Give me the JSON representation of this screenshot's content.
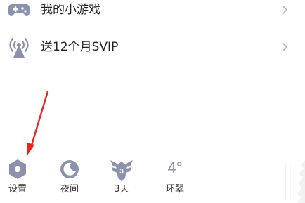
{
  "menu": {
    "items": [
      {
        "label": "我的小游戏",
        "icon": "gamepad-icon"
      },
      {
        "label": "送12个月SVIP",
        "icon": "broadcast-tower-icon"
      }
    ]
  },
  "bottom_bar": {
    "items": [
      {
        "label": "设置",
        "icon": "settings-hexagon-icon"
      },
      {
        "label": "夜间",
        "icon": "moon-icon"
      },
      {
        "label": "3天",
        "icon": "badge-icon"
      },
      {
        "label": "环翠",
        "icon": "weather-temperature",
        "temperature": "4°"
      }
    ]
  },
  "colors": {
    "icon": "#8c91ad",
    "arrow": "#e8251f",
    "text": "#222222"
  }
}
